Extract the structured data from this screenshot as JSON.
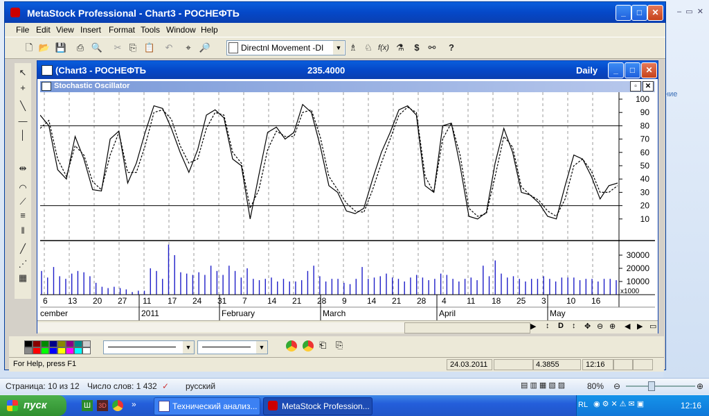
{
  "app": {
    "title": "MetaStock Professional - Chart3 - РОСНЕФТЬ",
    "menu": [
      "File",
      "Edit",
      "View",
      "Insert",
      "Format",
      "Tools",
      "Window",
      "Help"
    ],
    "indicator_combo": "Directnl Movement -DI"
  },
  "chart_window": {
    "title": "(Chart3 - РОСНЕФТЬ",
    "price": "235.4000",
    "periodicity": "Daily",
    "oscillator_title": "Stochastic Oscillator"
  },
  "x_axis": {
    "day_labels": [
      "6",
      "13",
      "20",
      "27",
      "11",
      "17",
      "24",
      "31",
      "7",
      "14",
      "21",
      "28",
      "9",
      "14",
      "21",
      "28",
      "4",
      "11",
      "18",
      "25",
      "3",
      "10",
      "16"
    ],
    "month_labels": [
      "cember",
      "2011",
      "February",
      "March",
      "April",
      "May"
    ]
  },
  "volume_scale": {
    "multiplier": "x1000"
  },
  "chart_data": [
    {
      "type": "line",
      "ylim": [
        0,
        100
      ],
      "y_ticks": [
        "100",
        "90",
        "80",
        "70",
        "60",
        "50",
        "40",
        "30",
        "20",
        "10"
      ],
      "reference_lines": [
        80,
        20
      ],
      "series": [
        {
          "values": [
            88,
            80,
            47,
            40,
            72,
            55,
            32,
            31,
            70,
            76,
            37,
            52,
            75,
            95,
            93,
            78,
            60,
            45,
            62,
            88,
            92,
            86,
            55,
            50,
            10,
            43,
            75,
            79,
            70,
            75,
            96,
            90,
            65,
            35,
            30,
            16,
            14,
            18,
            40,
            60,
            75,
            92,
            95,
            88,
            35,
            30,
            80,
            82,
            50,
            12,
            10,
            15,
            52,
            78,
            60,
            30,
            28,
            22,
            12,
            10,
            35,
            58,
            55,
            42,
            25,
            35,
            37
          ]
        },
        {
          "values": [
            78,
            84,
            55,
            42,
            65,
            58,
            38,
            32,
            58,
            75,
            45,
            45,
            65,
            90,
            92,
            85,
            65,
            52,
            55,
            78,
            90,
            88,
            60,
            52,
            18,
            32,
            62,
            76,
            72,
            72,
            90,
            92,
            72,
            42,
            32,
            22,
            16,
            15,
            32,
            52,
            70,
            88,
            94,
            90,
            42,
            30,
            70,
            82,
            58,
            18,
            12,
            14,
            42,
            72,
            64,
            34,
            28,
            24,
            16,
            12,
            25,
            50,
            55,
            46,
            30,
            30,
            35
          ]
        }
      ]
    },
    {
      "type": "bar",
      "ylim": [
        0,
        40000
      ],
      "y_ticks": [
        "30000",
        "20000",
        "10000"
      ],
      "values": [
        18000,
        13000,
        21000,
        14000,
        12000,
        16000,
        18000,
        17000,
        14000,
        9000,
        6000,
        5000,
        6000,
        5000,
        4000,
        2000,
        3000,
        3000,
        20000,
        18000,
        12000,
        38000,
        30000,
        17000,
        16000,
        15000,
        17000,
        15000,
        22000,
        18000,
        15000,
        22000,
        18000,
        13000,
        20000,
        12000,
        11000,
        12000,
        13000,
        10000,
        12000,
        10000,
        10000,
        11000,
        18000,
        22000,
        14000,
        10000,
        12000,
        12000,
        9000,
        8000,
        12000,
        21000,
        12000,
        13000,
        14000,
        16000,
        13000,
        12000,
        10000,
        13000,
        15000,
        13000,
        11000,
        12000,
        16000,
        15000,
        12000,
        10000,
        12000,
        13000,
        11000,
        22000,
        14000,
        26000,
        16000,
        13000,
        14000,
        12000,
        10000,
        12000,
        12000,
        14000,
        12000,
        10000,
        13000,
        13000,
        13000,
        11000,
        12000,
        12000,
        10000,
        12000,
        12000,
        11000
      ]
    }
  ],
  "status": {
    "help": "For Help, press F1",
    "date": "24.03.2011",
    "value": "4.3855",
    "time": "12:16"
  },
  "word_status": {
    "page": "Страница: 10 из 12",
    "words": "Число слов: 1 432",
    "language": "русский",
    "zoom": "80%"
  },
  "taskbar": {
    "start": "пуск",
    "items": [
      "Технический анализ...",
      "MetaStock Profession..."
    ],
    "lang": "RL",
    "clock": "12:16"
  },
  "colors": {
    "titlebar": "#0a4fd0",
    "volume": "#1c1cc8",
    "price_line": "#000000"
  }
}
